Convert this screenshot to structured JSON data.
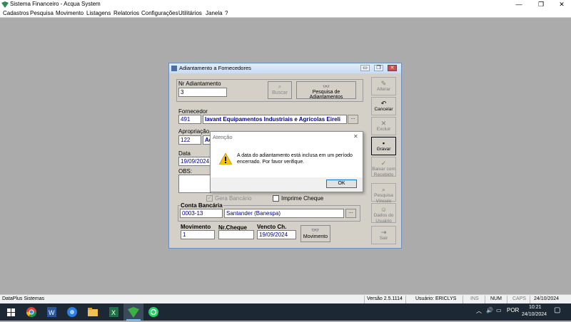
{
  "window": {
    "title": "Sistema Financeiro - Acqua System",
    "minimize": "—",
    "maximize": "❐",
    "close": "✕"
  },
  "menu": [
    "Cadastros",
    "Pesquisa",
    "Movimento",
    "Listagens",
    "Relatorios",
    "Configurações",
    "Utilitários",
    "Janela",
    "?"
  ],
  "child": {
    "title": "Adiantamento a Fornecedores",
    "nr_label": "Nr Adiantamento",
    "nr_value": "3",
    "buscar_label": "Buscar",
    "pesquisa_label": "Pesquisa de Adiantamentos",
    "fornecedor_label": "Fornecedor",
    "fornecedor_code": "491",
    "fornecedor_name": "Iavant Equipamentos Industriais e Agrícolas Eireli",
    "apropriacao_label": "Apropriação",
    "apropriacao_code": "122",
    "apropriacao_name": "Ad",
    "data_label": "Data",
    "data_value": "19/09/2024",
    "obs_label": "OBS:",
    "gera_bancario": "Gera Bancário",
    "imprime_cheque": "Imprime Cheque",
    "conta_label": "Conta Bancária",
    "conta_code": "0003-13",
    "conta_name": "Santander (Banespa)",
    "movimento_label": "Movimento",
    "movimento_value": "1",
    "nrcheque_label": "Nr.Cheque",
    "nrcheque_value": "",
    "vencto_label": "Vencto Ch.",
    "vencto_value": "19/09/2024",
    "movimento_btn": "Movimento",
    "ellipsis": "...",
    "side_buttons": [
      "Alterar",
      "Cancelar",
      "Excluir",
      "Gravar",
      "Baixar com Recebido",
      "Pesquisa Vínculo",
      "Dados do Usuário",
      "Sair"
    ]
  },
  "dialog": {
    "title": "Atenção",
    "message": "A data do adiantamento está inclusa em um período encerrado. Por favor verifique.",
    "ok": "OK",
    "close": "✕"
  },
  "status": {
    "company": "DataPlus Sistemas",
    "version": "Versão 2.5.1114",
    "user": "Usuário: ERICLYS",
    "ins": "INS",
    "num": "NUM",
    "caps": "CAPS",
    "date": "24/10/2024"
  },
  "taskbar": {
    "lang": "POR",
    "time": "10:21",
    "date": "24/10/2024"
  }
}
